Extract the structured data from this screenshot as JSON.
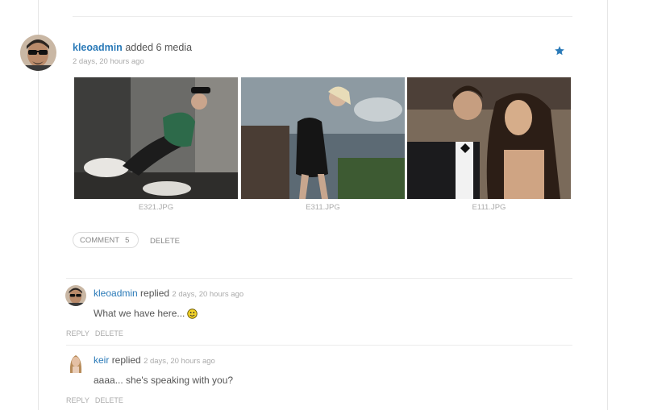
{
  "activity": {
    "author": "kleoadmin",
    "action": "added 6 media",
    "time": "2 days, 20 hours ago",
    "favorite_icon": "star-icon",
    "accent_color": "#2a7ab8"
  },
  "media": [
    {
      "caption": "E321.JPG"
    },
    {
      "caption": "E311.JPG"
    },
    {
      "caption": "E111.JPG"
    }
  ],
  "actions": {
    "comment_label": "COMMENT",
    "comment_count": "5",
    "delete_label": "DELETE"
  },
  "replies": [
    {
      "author": "kleoadmin",
      "verb": "replied",
      "time": "2 days, 20 hours ago",
      "text": "What we have here...",
      "emoji": "smiley-icon",
      "reply_label": "REPLY",
      "delete_label": "DELETE"
    },
    {
      "author": "keir",
      "verb": "replied",
      "time": "2 days, 20 hours ago",
      "text": "aaaa... she's speaking with you?",
      "reply_label": "REPLY",
      "delete_label": "DELETE"
    }
  ]
}
